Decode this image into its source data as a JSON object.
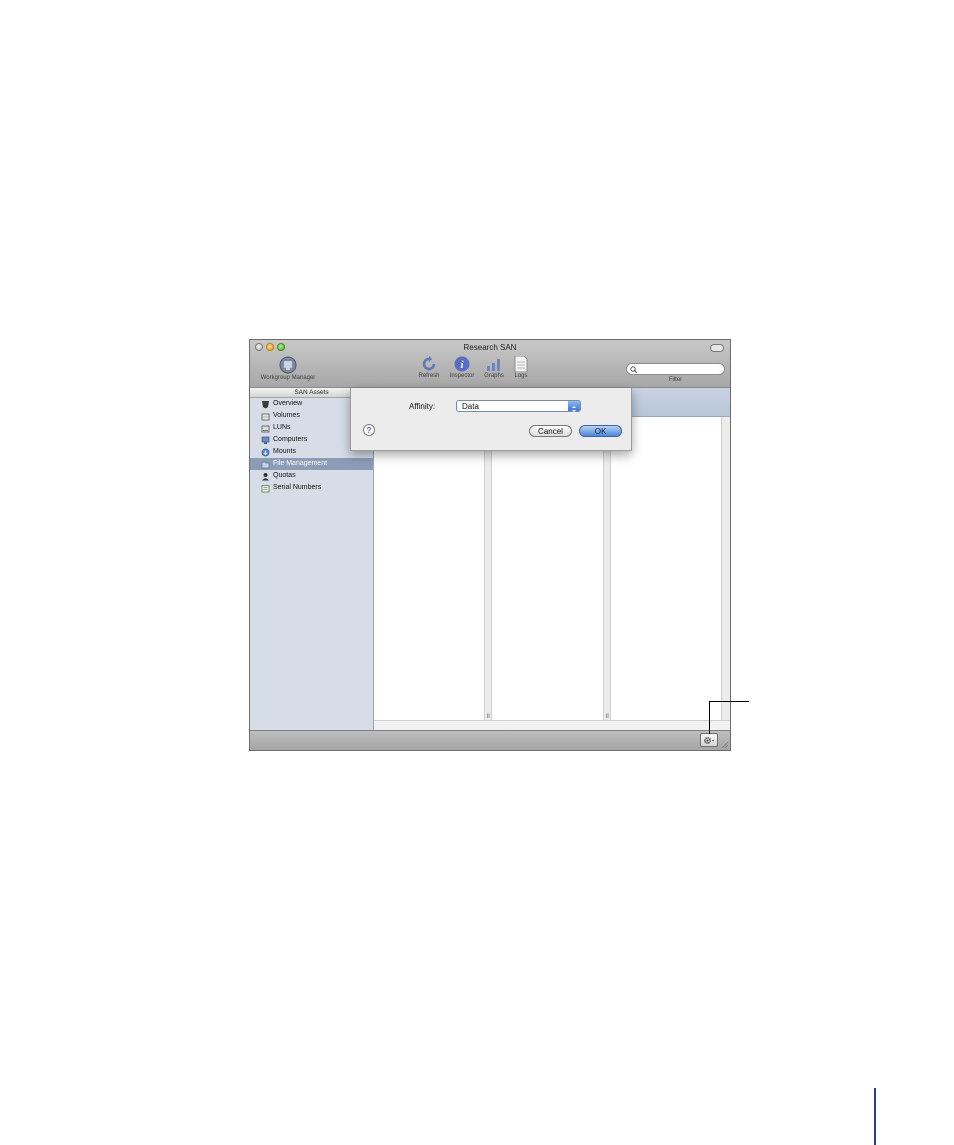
{
  "window": {
    "title": "Research SAN"
  },
  "toolbar": {
    "workgroup_manager_label": "Workgroup Manager",
    "refresh_label": "Refresh",
    "inspector_label": "Inspector",
    "graphs_label": "Graphs",
    "logs_label": "Logs",
    "filter_label": "Filter",
    "search_placeholder": ""
  },
  "sidebar": {
    "header": "SAN Assets",
    "items": [
      {
        "label": "Overview",
        "icon": "overview-icon"
      },
      {
        "label": "Volumes",
        "icon": "volume-icon"
      },
      {
        "label": "LUNs",
        "icon": "lun-icon"
      },
      {
        "label": "Computers",
        "icon": "computer-icon"
      },
      {
        "label": "Mounts",
        "icon": "mount-icon"
      },
      {
        "label": "File Management",
        "icon": "folder-icon",
        "selected": true
      },
      {
        "label": "Quotas",
        "icon": "user-icon"
      },
      {
        "label": "Serial Numbers",
        "icon": "serial-number-icon"
      }
    ]
  },
  "sheet": {
    "affinity_label": "Affinity:",
    "affinity_value": "Data",
    "cancel_label": "Cancel",
    "ok_label": "OK",
    "help_glyph": "?"
  },
  "bottom_bar": {
    "action_icon": "gear-icon"
  },
  "colors": {
    "selection": "#8c9bb6",
    "sidebar_bg": "#d6dde7",
    "default_button": "#4c86d9",
    "page_rule": "#2a3b9a"
  }
}
